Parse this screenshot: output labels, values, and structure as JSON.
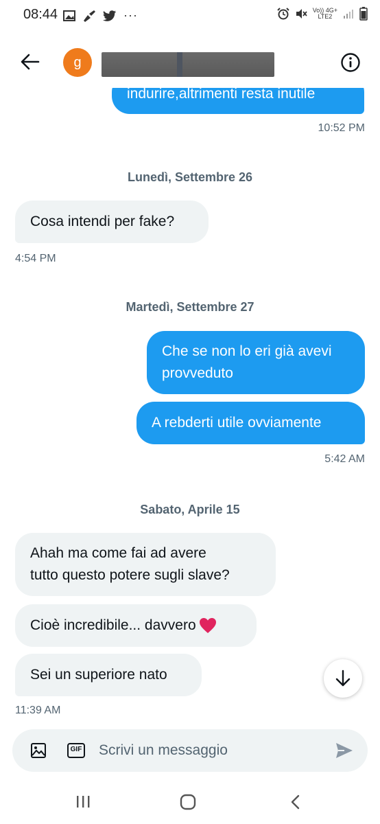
{
  "status_bar": {
    "time": "08:44",
    "network_top": "Vo)) 4G+",
    "network_bottom": "LTE2"
  },
  "header": {
    "avatar_letter": "g",
    "name_redacted": true
  },
  "messages": {
    "m0": {
      "text": "indurire,altrimenti resta inutile",
      "time": "10:52 PM"
    },
    "d1": "Lunedì, Settembre 26",
    "m1": {
      "text": "Cosa intendi per fake?",
      "time": "4:54 PM"
    },
    "d2": "Martedì, Settembre 27",
    "m2": {
      "line1": "Che se non lo eri già avevi",
      "line2": "provveduto"
    },
    "m3": {
      "text": "A rebderti utile ovviamente",
      "time": "5:42 AM"
    },
    "d3": "Sabato, Aprile 15",
    "m4": {
      "line1": "Ahah ma come fai ad avere",
      "line2": "tutto questo potere sugli slave?"
    },
    "m5": {
      "text": "Cioè incredibile... davvero"
    },
    "m6": {
      "text": "Sei un superiore nato",
      "time": "11:39 AM"
    }
  },
  "composer": {
    "placeholder": "Scrivi un messaggio",
    "gif_label": "GIF"
  },
  "colors": {
    "accent": "#1d9bf0",
    "received_bubble": "#eff3f4",
    "avatar": "#ef7b1c",
    "heart": "#e0245e"
  },
  "icons": [
    "back-arrow-icon",
    "info-icon",
    "image-icon",
    "gif-icon",
    "send-icon",
    "arrow-down-icon",
    "heart-icon"
  ]
}
